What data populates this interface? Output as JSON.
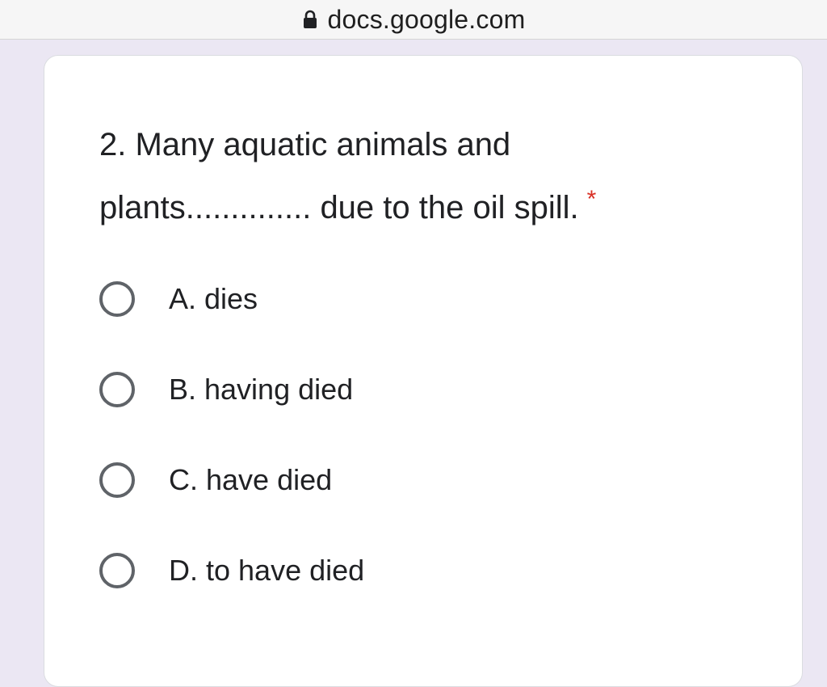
{
  "browser": {
    "url": "docs.google.com",
    "lock_icon": "lock-icon"
  },
  "form": {
    "question": {
      "line1": "2. Many aquatic animals and",
      "line2": "plants.............. due to the oil spill.",
      "required_marker": "*"
    },
    "options": [
      {
        "label": "A. dies",
        "selected": false
      },
      {
        "label": "B. having died",
        "selected": false
      },
      {
        "label": "C. have died",
        "selected": false
      },
      {
        "label": "D. to have died",
        "selected": false
      }
    ]
  },
  "colors": {
    "background": "#ebe7f3",
    "card": "#ffffff",
    "radio_border": "#5f6368",
    "required": "#d93025"
  }
}
